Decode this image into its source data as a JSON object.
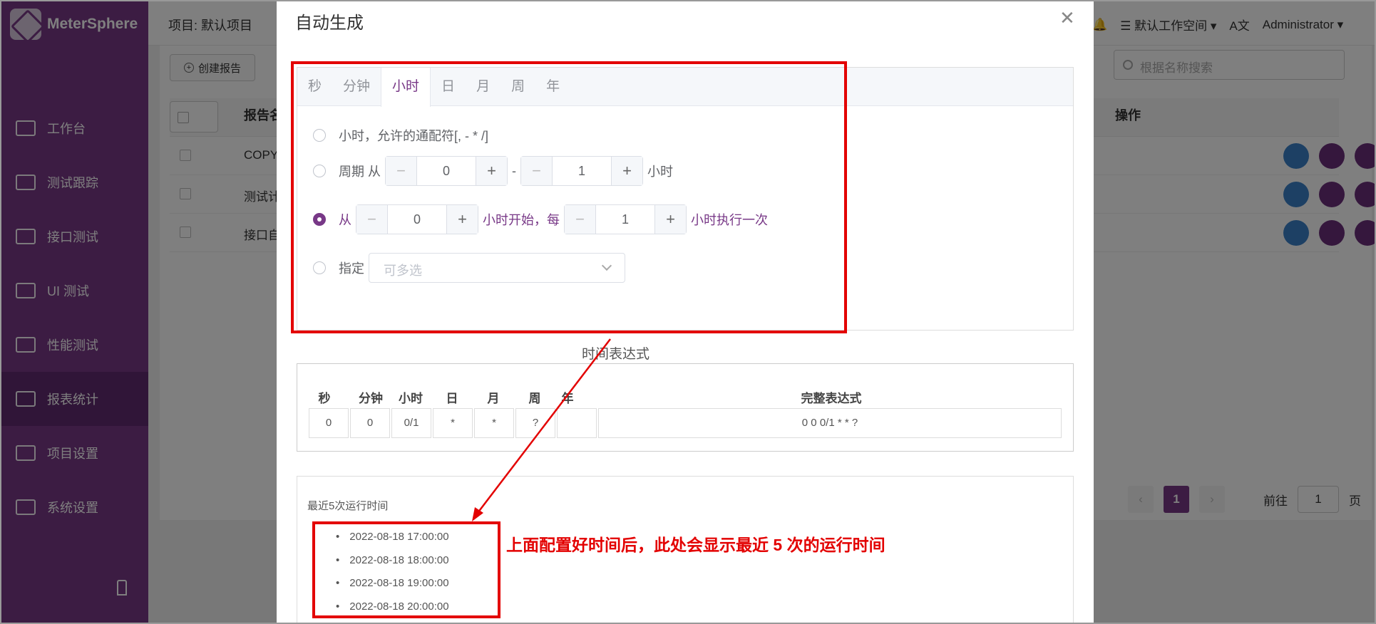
{
  "app": {
    "logo_text": "MeterSphere",
    "project_label": "项目: 默认项目",
    "workspace": "默认工作空间",
    "user": "Administrator"
  },
  "sidebar": {
    "items": [
      {
        "label": "工作台",
        "icon": "monitor-icon"
      },
      {
        "label": "测试跟踪",
        "icon": "clipboard-icon"
      },
      {
        "label": "接口测试",
        "icon": "api-icon"
      },
      {
        "label": "UI 测试",
        "icon": "ui-icon"
      },
      {
        "label": "性能测试",
        "icon": "performance-icon"
      },
      {
        "label": "报表统计",
        "icon": "report-icon"
      },
      {
        "label": "项目设置",
        "icon": "folder-icon"
      },
      {
        "label": "系统设置",
        "icon": "gears-icon"
      }
    ],
    "active_index": 5
  },
  "page": {
    "create_button": "创建报告",
    "search_placeholder": "根据名称搜索",
    "col_report": "报告名",
    "col_ops": "操作",
    "rows": [
      "COPY",
      "测试计",
      "接口自"
    ],
    "pager": {
      "current": "1",
      "goto_label": "前往",
      "goto_value": "1",
      "page_suffix": "页"
    }
  },
  "dialog": {
    "title": "自动生成",
    "tabs": [
      "秒",
      "分钟",
      "小时",
      "日",
      "月",
      "周",
      "年"
    ],
    "active_tab": 2,
    "options": {
      "wildcard": "小时，允许的通配符[, - * /]",
      "period_prefix": "周期 从",
      "period_from": "0",
      "period_to": "1",
      "period_suffix": "小时",
      "from_label": "从",
      "start_value": "0",
      "start_text": "小时开始，每",
      "every_value": "1",
      "every_text": "小时执行一次",
      "specify_label": "指定",
      "specify_placeholder": "可多选"
    },
    "expression": {
      "label": "时间表达式",
      "headers": [
        "秒",
        "分钟",
        "小时",
        "日",
        "月",
        "周",
        "年",
        "完整表达式"
      ],
      "values": [
        "0",
        "0",
        "0/1",
        "*",
        "*",
        "?",
        "",
        "0 0 0/1 * * ?"
      ]
    },
    "runs": {
      "title": "最近5次运行时间",
      "times": [
        "2022-08-18 17:00:00",
        "2022-08-18 18:00:00",
        "2022-08-18 19:00:00",
        "2022-08-18 20:00:00"
      ]
    }
  },
  "annotation": {
    "text": "上面配置好时间后，此处会显示最近 5 次的运行时间",
    "color": "#e30000"
  },
  "colors": {
    "brand": "#783887",
    "sidebar_active": "#612b70"
  }
}
